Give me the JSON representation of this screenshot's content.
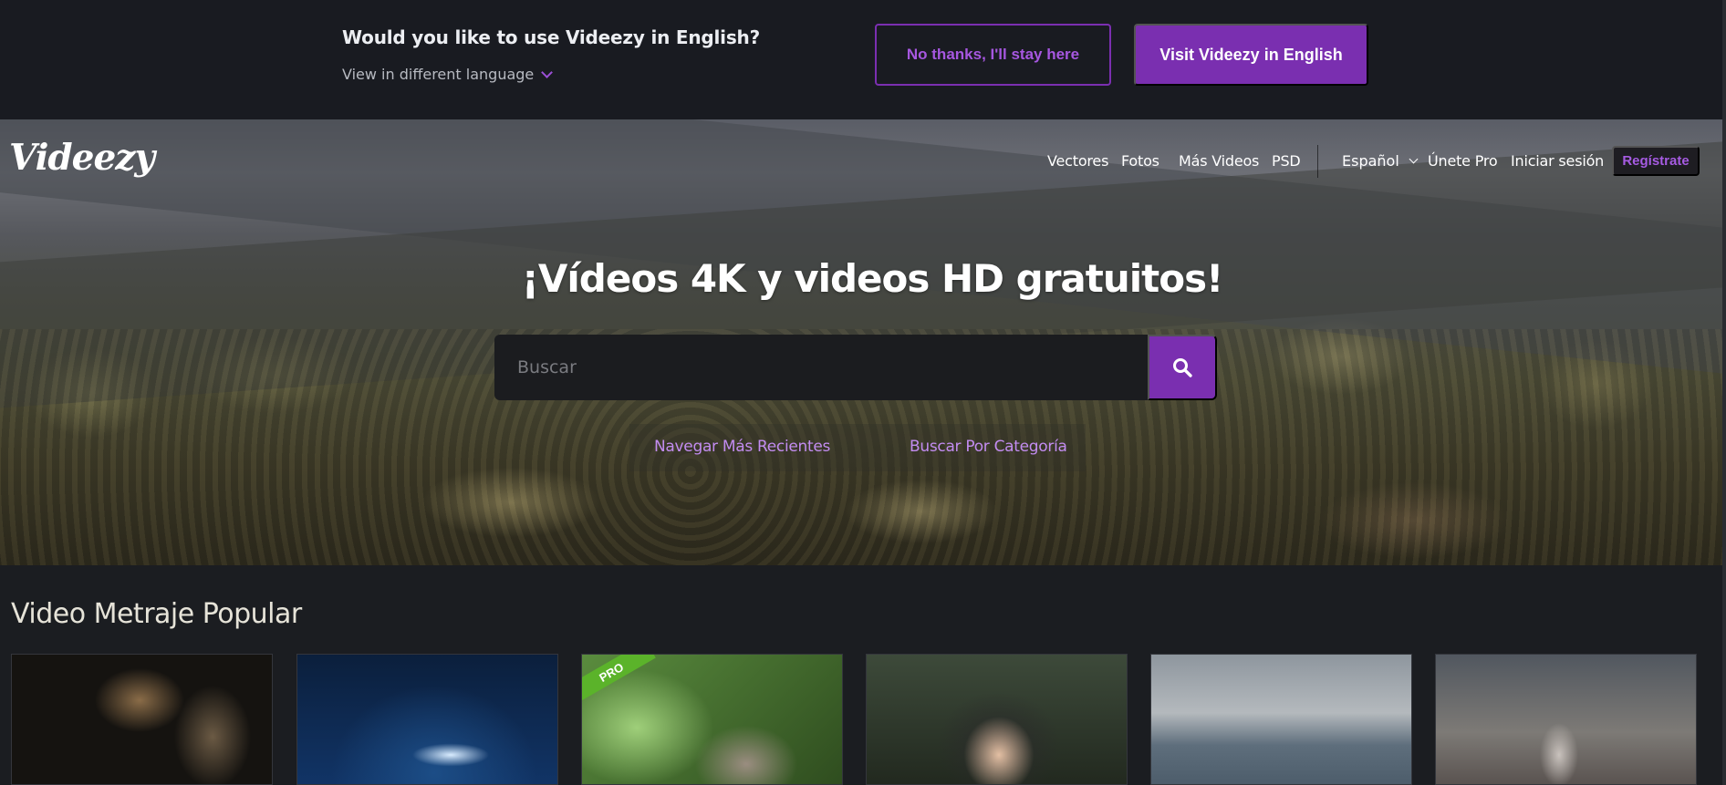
{
  "banner": {
    "question": "Would you like to use Videezy in English?",
    "switch_label": "View in different language",
    "stay_label": "No thanks, I'll stay here",
    "visit_label": "Visit Videezy in English"
  },
  "brand": {
    "logo": "Videezy",
    "accent": "#7a2fb0"
  },
  "nav": {
    "items": [
      "Vectores",
      "Fotos",
      "Más Videos",
      "PSD"
    ],
    "language": "Español",
    "pro": "Únete Pro",
    "login": "Iniciar sesión",
    "register": "Regístrate"
  },
  "hero": {
    "title": "¡Vídeos 4K y videos HD gratuitos!",
    "search_placeholder": "Buscar",
    "link_recent": "Navegar Más Recientes",
    "link_category": "Buscar Por Categoría"
  },
  "popular": {
    "title": "Video Metraje Popular",
    "badge": "PRO"
  },
  "icons": {
    "search": "search-icon",
    "chevron": "chevron-down-icon"
  }
}
